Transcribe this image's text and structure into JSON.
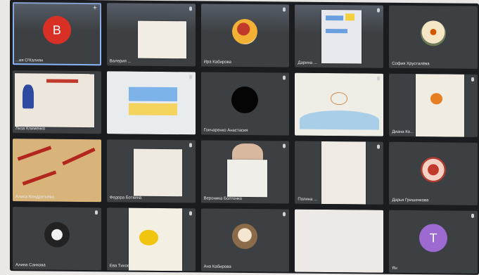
{
  "participants": [
    {
      "id": "p1",
      "initial": "B",
      "name": "...ия О'Калиян",
      "avatar": "red-letter",
      "active": true
    },
    {
      "id": "p2",
      "name": "Валерия ...",
      "kind": "drawing-paper"
    },
    {
      "id": "p3",
      "name": "Ира Кабирова",
      "kind": "photo-avatar"
    },
    {
      "id": "p4",
      "name": "Дарина ...",
      "kind": "drawing-paper"
    },
    {
      "id": "p5",
      "name": "София Хрусталёва",
      "kind": "photo-avatar"
    },
    {
      "id": "p6",
      "name": "Лиза Клименко",
      "kind": "drawing-paper"
    },
    {
      "id": "p7",
      "name": "",
      "kind": "drawing-paper"
    },
    {
      "id": "p8",
      "name": "Гончаренко Анастасия",
      "kind": "black-avatar"
    },
    {
      "id": "p9",
      "name": "",
      "kind": "drawing-paper"
    },
    {
      "id": "p10",
      "name": "Диана Ко...",
      "kind": "drawing-paper"
    },
    {
      "id": "p11",
      "name": "Алиса Кондратьева",
      "kind": "drawing-paper"
    },
    {
      "id": "p12",
      "name": "Федора Боткина",
      "kind": "drawing-paper"
    },
    {
      "id": "p13",
      "name": "Вероника Болтенко",
      "kind": "drawing-paper"
    },
    {
      "id": "p14",
      "name": "Полина ...",
      "kind": "drawing-paper"
    },
    {
      "id": "p15",
      "name": "Дарья Гришенкова",
      "kind": "photo-avatar"
    },
    {
      "id": "p16",
      "name": "Алина Санкова",
      "kind": "photo-avatar"
    },
    {
      "id": "p17",
      "name": "Ева Тихова",
      "kind": "drawing-paper"
    },
    {
      "id": "p18",
      "name": "Ана Кабирова",
      "kind": "photo-avatar"
    },
    {
      "id": "p19",
      "name": "",
      "kind": "drawing-paper"
    },
    {
      "id": "p20",
      "initial": "T",
      "name": "Ян",
      "avatar": "purple-letter"
    }
  ],
  "colors": {
    "grid_bg": "#1b1c1f",
    "tile_bg": "#3c4043",
    "active_outline": "#8ab4f8",
    "avatar_red": "#d93025",
    "avatar_purple": "#9c6ad0"
  }
}
